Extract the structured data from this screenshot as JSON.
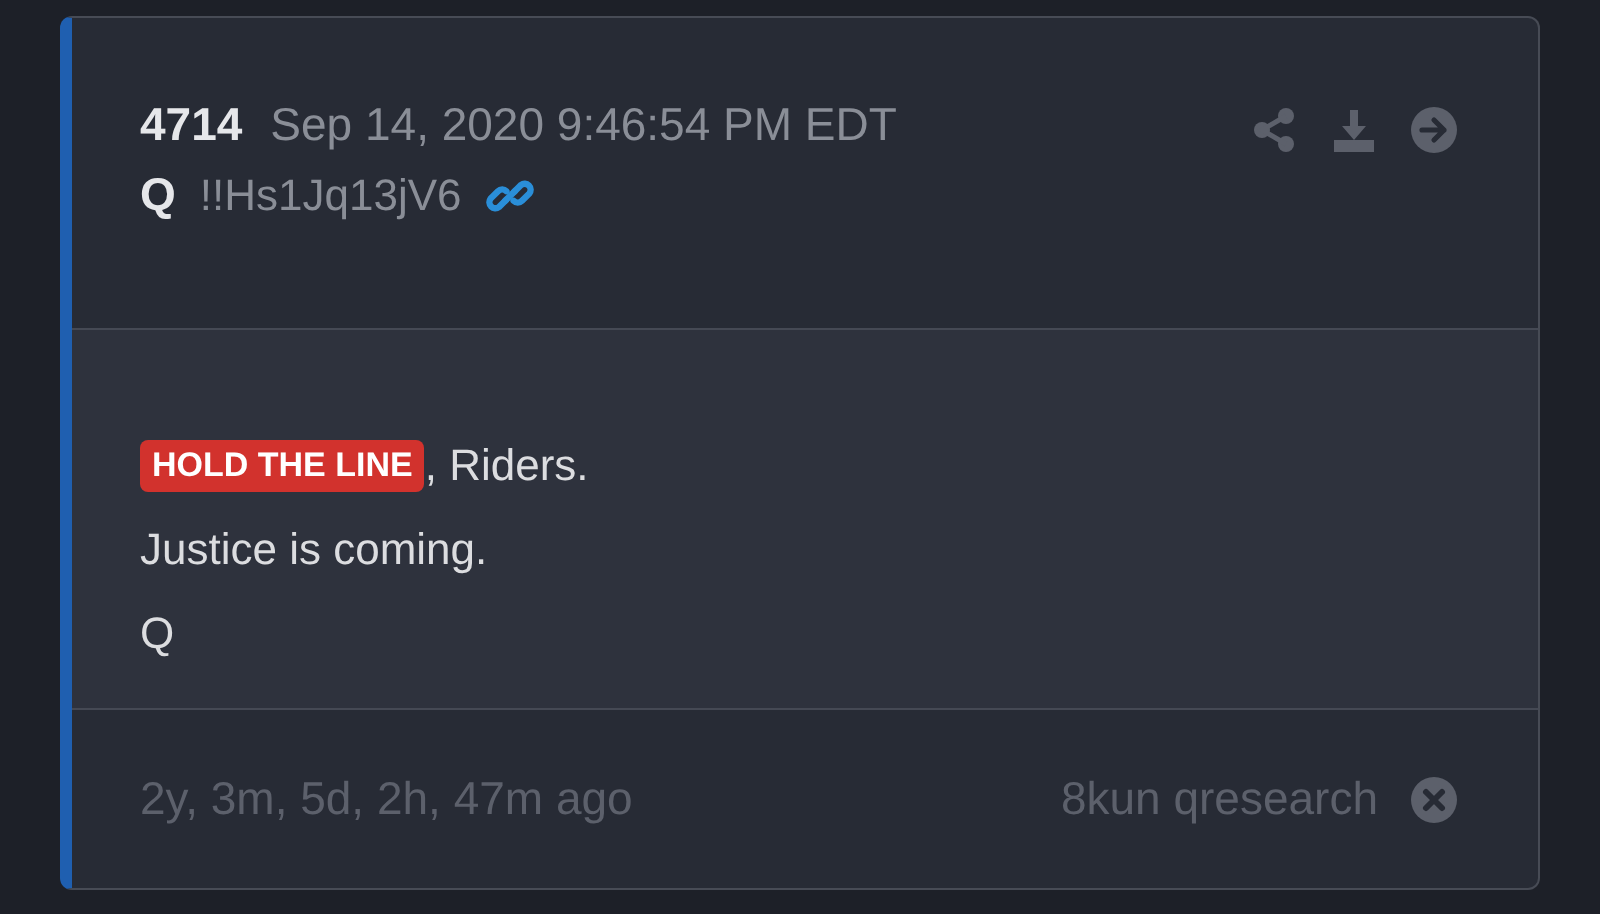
{
  "post": {
    "number": "4714",
    "timestamp": "Sep 14, 2020 9:46:54 PM EDT",
    "author": "Q",
    "tripcode": "!!Hs1Jq13jV6"
  },
  "message": {
    "lines": [
      {
        "segments": [
          {
            "kind": "highlight",
            "text": "HOLD THE LINE"
          },
          {
            "kind": "plain",
            "text": ", Riders."
          }
        ]
      },
      {
        "segments": [
          {
            "kind": "plain",
            "text": "Justice is coming."
          }
        ]
      },
      {
        "segments": [
          {
            "kind": "plain",
            "text": "Q"
          }
        ]
      }
    ]
  },
  "footer": {
    "age": "2y, 3m, 5d, 2h, 47m ago",
    "source": "8kun qresearch"
  }
}
